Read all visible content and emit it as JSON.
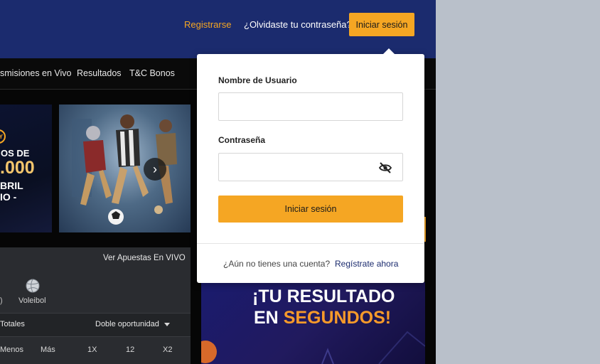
{
  "header": {
    "register_label": "Registrarse",
    "forgot_label": "¿Olvidaste tu contraseña?",
    "login_label": "Iniciar sesión"
  },
  "nav": {
    "items": [
      "smisiones en Vivo",
      "Resultados",
      "T&C Bonos"
    ]
  },
  "banner_left": {
    "badge": "Y",
    "line1": "OS DE",
    "amount": ".000",
    "line3": "BRIL",
    "line4": "IO -"
  },
  "sports": {
    "live_link": "Ver Apuestas En VIVO",
    "partial_paren": ")",
    "volleyball_label": "Voleibol",
    "totals_label": "Totales",
    "market_select": "Doble oportunidad",
    "columns": [
      "Menos",
      "Más",
      "1X",
      "12",
      "X2"
    ]
  },
  "banner_right": {
    "line1": "¡TU RESULTADO",
    "line2_white": "EN ",
    "line2_orange": "SEGUNDOS!"
  },
  "login_form": {
    "username_label": "Nombre de Usuario",
    "username_value": "",
    "password_label": "Contraseña",
    "password_value": "",
    "submit_label": "Iniciar sesión",
    "no_account_text": "¿Aún no tienes una cuenta?",
    "register_now_label": "Regístrate ahora"
  },
  "icons": {
    "password_toggle": "eye-off-icon",
    "carousel_next": "chevron-right-icon",
    "volleyball": "volleyball-icon",
    "dropdown": "caret-down-icon"
  },
  "colors": {
    "header_bg": "#1b2b6e",
    "accent": "#f5a623",
    "page_bg": "#060606",
    "panel_bg": "#2a2c30"
  }
}
